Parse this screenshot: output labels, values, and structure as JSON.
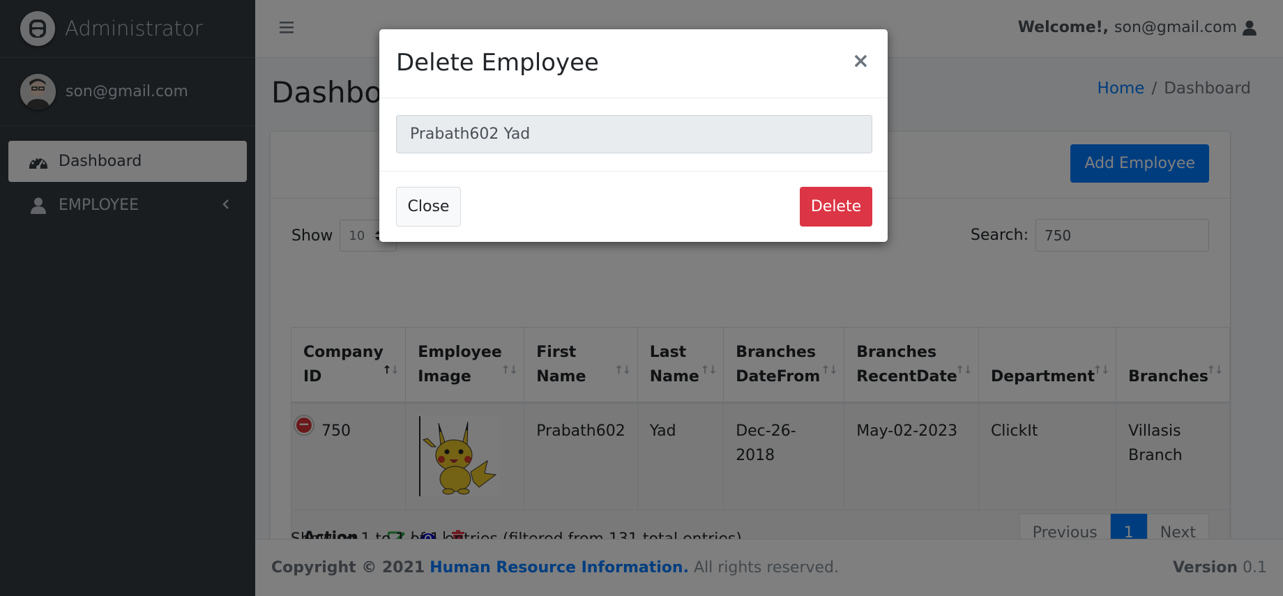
{
  "brand": {
    "name": "Administrator",
    "logo_icon": "letter-a-logo-icon"
  },
  "user": {
    "email": "son@gmail.com"
  },
  "sidebar": {
    "items": [
      {
        "label": "Dashboard",
        "icon": "tachometer-icon",
        "active": true
      },
      {
        "label": "EMPLOYEE",
        "icon": "user-icon",
        "active": false
      }
    ]
  },
  "topbar": {
    "welcome_bold": "Welcome!,",
    "welcome_user": "son@gmail.com"
  },
  "page": {
    "title": "Dashboard",
    "breadcrumb": {
      "home": "Home",
      "sep": "/",
      "current": "Dashboard"
    }
  },
  "card": {
    "add_button": "Add Employee",
    "show_label": "Show",
    "page_length": "10",
    "search_label": "Search:",
    "search_value": "750"
  },
  "table": {
    "headers": [
      "Company ID",
      "Employee Image",
      "First Name",
      "Last Name",
      "Branches DateFrom",
      "Branches RecentDate",
      "Department",
      "Branches"
    ],
    "row": {
      "company_id": "750",
      "first_name": "Prabath602",
      "last_name": "Yad",
      "date_from": "Dec-26-2018",
      "recent_date": "May-02-2023",
      "department": "ClickIt",
      "branches": "Villasis Branch"
    },
    "action_label": "Action",
    "action_sep": "|"
  },
  "info_text": "Showing 1 to 1 of 1 entries (filtered from 131 total entries)",
  "pager": {
    "previous": "Previous",
    "current": "1",
    "next": "Next"
  },
  "footer": {
    "copyright": "Copyright © 2021",
    "org": "Human Resource Information.",
    "rights": "All rights reserved.",
    "version_label": "Version",
    "version": "0.1"
  },
  "modal": {
    "title": "Delete Employee",
    "close_glyph": "×",
    "employee_name": "Prabath602 Yad",
    "close_button": "Close",
    "delete_button": "Delete"
  },
  "colors": {
    "sidebar_bg": "#343a40",
    "primary": "#007bff",
    "danger": "#dc3545",
    "success": "#28a745"
  }
}
